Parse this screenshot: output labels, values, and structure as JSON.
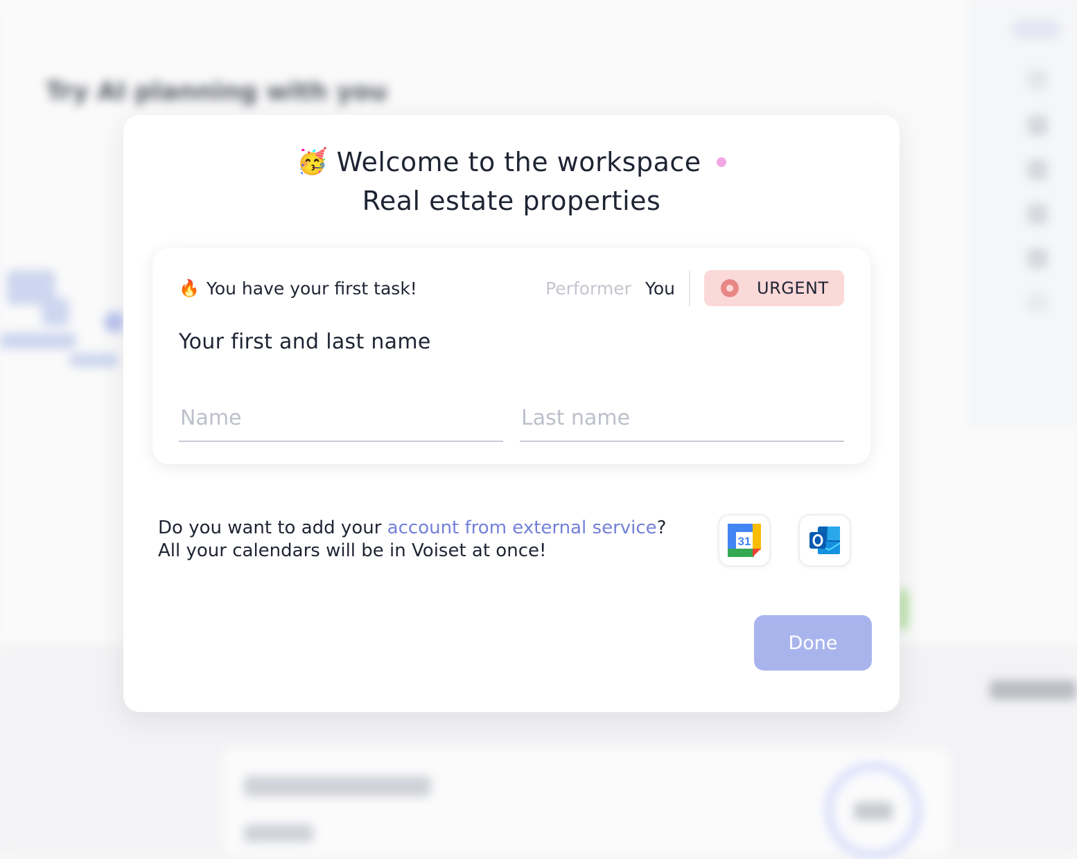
{
  "background": {
    "title": "Try AI planning with you"
  },
  "modal": {
    "title_emoji": "🥳",
    "title": "Welcome to the workspace",
    "subtitle": "Real estate properties",
    "task": {
      "emoji": "🔥",
      "heading": "You have your first task!",
      "performer_label": "Performer",
      "performer_value": "You",
      "priority": "URGENT",
      "section_title": "Your first and last name",
      "name_placeholder": "Name",
      "lastname_placeholder": "Last name"
    },
    "external": {
      "prefix": "Do you want to add your ",
      "link": "account from external service",
      "suffix": "?",
      "line2": "All your calendars will be in Voiset at once!",
      "google_date": "31"
    },
    "done_label": "Done"
  },
  "colors": {
    "accent": "#7380d8",
    "done_button": "#aab4ec",
    "urgent_bg": "#fbd9d9",
    "urgent_icon": "#e98787",
    "status_dot": "#f1a7e4"
  }
}
